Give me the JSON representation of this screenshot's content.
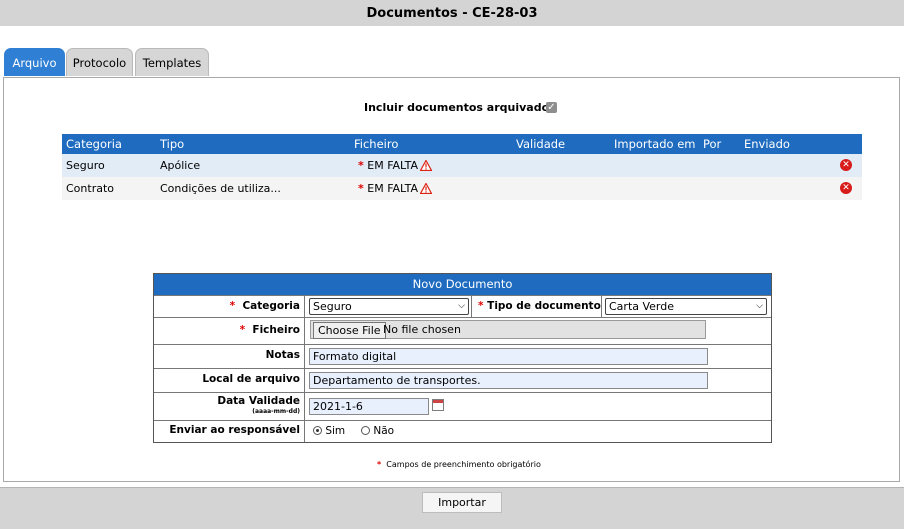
{
  "window": {
    "title": "Documentos - CE-28-03"
  },
  "tabs": [
    {
      "label": "Arquivo",
      "active": true
    },
    {
      "label": "Protocolo",
      "active": false
    },
    {
      "label": "Templates",
      "active": false
    }
  ],
  "include_archived": {
    "label": "Incluir documentos arquivados",
    "checked": true
  },
  "documents": {
    "columns": [
      "Categoria",
      "Tipo",
      "Ficheiro",
      "Validade",
      "Importado em",
      "Por",
      "Enviado"
    ],
    "rows": [
      {
        "categoria": "Seguro",
        "tipo": "Apólice",
        "ficheiro": "EM FALTA",
        "validade": "",
        "importado_em": "",
        "por": "",
        "enviado": ""
      },
      {
        "categoria": "Contrato",
        "tipo": "Condições de utiliza...",
        "ficheiro": "EM FALTA",
        "validade": "",
        "importado_em": "",
        "por": "",
        "enviado": ""
      }
    ],
    "delete_icon": "delete-icon",
    "warning_icon": "warning-icon"
  },
  "form": {
    "title": "Novo Documento",
    "categoria": {
      "label": "Categoria",
      "value": "Seguro"
    },
    "tipo_documento": {
      "label": "Tipo de documento",
      "value": "Carta Verde"
    },
    "ficheiro": {
      "label": "Ficheiro",
      "button": "Choose File",
      "status": "No file chosen"
    },
    "notas": {
      "label": "Notas",
      "value": "Formato digital"
    },
    "local_arquivo": {
      "label": "Local de arquivo",
      "value": "Departamento de transportes."
    },
    "data_validade": {
      "label": "Data Validade",
      "hint": "(aaaa-mm-dd)",
      "value": "2021-1-6"
    },
    "enviar": {
      "label": "Enviar ao responsável",
      "options": [
        "Sim",
        "Não"
      ],
      "selected": "Sim"
    }
  },
  "required_note": "Campos de preenchimento obrigatório",
  "footer": {
    "import_label": "Importar"
  },
  "colors": {
    "accent": "#1e6bc0",
    "tab_active": "#2f7fd4",
    "required": "#dd0000"
  }
}
